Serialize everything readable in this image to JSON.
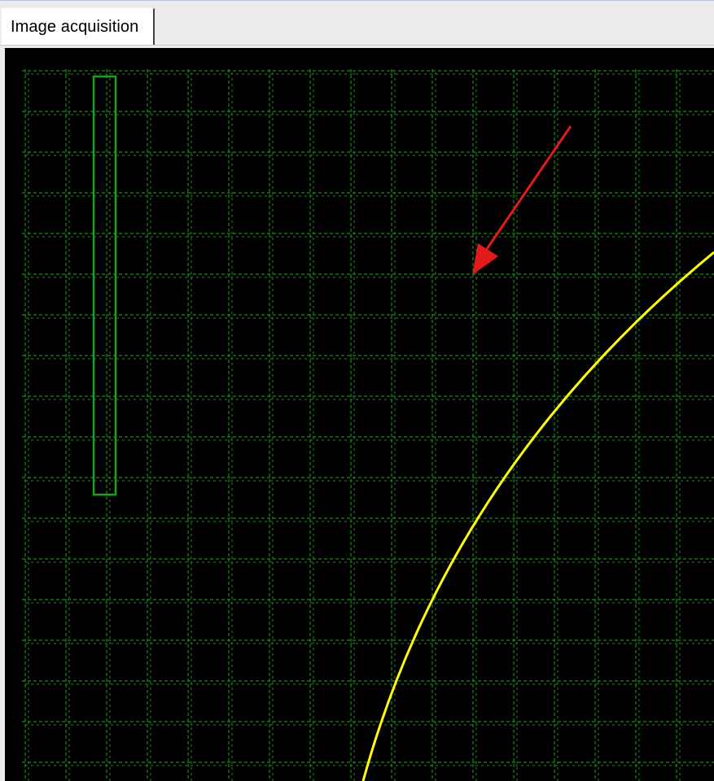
{
  "tabs": [
    {
      "label": "Image acquisition",
      "active": true
    }
  ],
  "colors": {
    "background": "#000000",
    "grid": "#1f8a1f",
    "roi": "#1ea01e",
    "circle": "#ffff00",
    "arrow": "#e11b1b"
  },
  "icons": {
    "arrow": "red-arrow-annotation"
  }
}
